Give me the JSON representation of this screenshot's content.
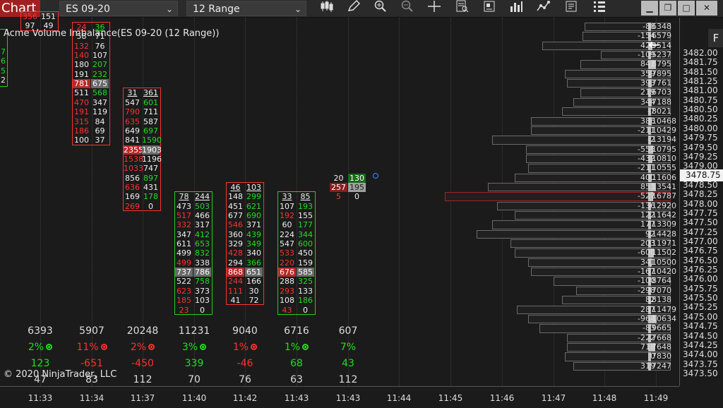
{
  "toolbar": {
    "chart_label": "Chart",
    "instrument": "ES 09-20",
    "interval": "12 Range",
    "icons": [
      "bar-type-icon",
      "draw-pencil-icon",
      "zoom-in-icon",
      "zoom-out-icon",
      "crosshair-icon",
      "data-box-icon",
      "templates-icon",
      "indicators-icon",
      "strategies-icon",
      "properties-icon",
      "more-icon"
    ],
    "window_buttons": [
      "minimize",
      "maximize",
      "close"
    ]
  },
  "chart_title": "Acme Volume Imbalance(ES 09-20 (12 Range))",
  "copyright": "© 2020 NinjaTrader, LLC",
  "price_axis": {
    "labels": [
      "3482.00",
      "3481.75",
      "3481.50",
      "3481.25",
      "3481.00",
      "3480.75",
      "3480.50",
      "3480.25",
      "3480.00",
      "3479.75",
      "3479.50",
      "3479.25",
      "3479.00",
      "3478.75",
      "3478.50",
      "3478.25",
      "3478.00",
      "3477.75",
      "3477.50",
      "3477.25",
      "3477.00",
      "3476.75",
      "3476.50",
      "3476.25",
      "3476.00",
      "3475.75",
      "3475.50",
      "3475.25",
      "3475.00",
      "3474.75",
      "3474.50",
      "3474.25",
      "3474.00",
      "3473.75",
      "3473.50"
    ],
    "current_price": "3478.75",
    "right_button": "F"
  },
  "time_axis": [
    "11:33",
    "11:34",
    "11:37",
    "11:40",
    "11:42",
    "11:43",
    "11:43",
    "11:44",
    "11:45",
    "11:46",
    "11:47",
    "11:48",
    "11:49"
  ],
  "bars": [
    {
      "rows": [
        [
          "356",
          "151"
        ],
        [
          "97",
          "49"
        ]
      ]
    },
    {
      "rows": [
        [
          "24",
          "36"
        ],
        [
          "58",
          "71"
        ],
        [
          "132",
          "76"
        ],
        [
          "140",
          "107"
        ],
        [
          "180",
          "207"
        ],
        [
          "191",
          "232"
        ],
        [
          "781",
          "675"
        ],
        [
          "511",
          "568"
        ],
        [
          "470",
          "347"
        ],
        [
          "191",
          "119"
        ],
        [
          "315",
          "84"
        ],
        [
          "186",
          "69"
        ],
        [
          "100",
          "37"
        ]
      ]
    },
    {
      "rows": [
        [
          "31",
          "361"
        ],
        [
          "547",
          "601"
        ],
        [
          "790",
          "711"
        ],
        [
          "635",
          "587"
        ],
        [
          "649",
          "697"
        ],
        [
          "841",
          "1590"
        ],
        [
          "2355",
          "1903"
        ],
        [
          "1538",
          "1196"
        ],
        [
          "1033",
          "747"
        ],
        [
          "856",
          "897"
        ],
        [
          "636",
          "431"
        ],
        [
          "169",
          "178"
        ],
        [
          "269",
          "0"
        ]
      ]
    },
    {
      "rows": [
        [
          "78",
          "244"
        ],
        [
          "473",
          "503"
        ],
        [
          "517",
          "466"
        ],
        [
          "332",
          "317"
        ],
        [
          "347",
          "412"
        ],
        [
          "611",
          "653"
        ],
        [
          "499",
          "832"
        ],
        [
          "499",
          "338"
        ],
        [
          "737",
          "786"
        ],
        [
          "522",
          "758"
        ],
        [
          "623",
          "373"
        ],
        [
          "185",
          "103"
        ],
        [
          "23",
          "0"
        ]
      ]
    },
    {
      "rows": [
        [
          "46",
          "103"
        ],
        [
          "148",
          "299"
        ],
        [
          "451",
          "621"
        ],
        [
          "677",
          "690"
        ],
        [
          "546",
          "371"
        ],
        [
          "360",
          "439"
        ],
        [
          "329",
          "349"
        ],
        [
          "428",
          "340"
        ],
        [
          "294",
          "366"
        ],
        [
          "868",
          "651"
        ],
        [
          "244",
          "166"
        ],
        [
          "111",
          "30"
        ],
        [
          "41",
          "72"
        ]
      ]
    },
    {
      "rows": [
        [
          "33",
          "85"
        ],
        [
          "107",
          "193"
        ],
        [
          "192",
          "155"
        ],
        [
          "60",
          "177"
        ],
        [
          "224",
          "344"
        ],
        [
          "547",
          "600"
        ],
        [
          "533",
          "450"
        ],
        [
          "220",
          "159"
        ],
        [
          "676",
          "585"
        ],
        [
          "288",
          "325"
        ],
        [
          "293",
          "133"
        ],
        [
          "108",
          "186"
        ],
        [
          "43",
          "0"
        ]
      ]
    },
    {
      "rows": [
        [
          "20",
          "130"
        ],
        [
          "257",
          "195"
        ],
        [
          "5",
          "0"
        ]
      ]
    }
  ],
  "left_edge_digits": [
    "7",
    "6",
    "5",
    "2"
  ],
  "summary": [
    {
      "volume": "6393",
      "pct": "2%",
      "delta": "123",
      "trades": "47"
    },
    {
      "volume": "5907",
      "pct": "11%",
      "delta": "-651",
      "trades": "83"
    },
    {
      "volume": "20248",
      "pct": "2%",
      "delta": "-450",
      "trades": "112"
    },
    {
      "volume": "11231",
      "pct": "3%",
      "delta": "339",
      "trades": "70"
    },
    {
      "volume": "9040",
      "pct": "1%",
      "delta": "-46",
      "trades": "76"
    },
    {
      "volume": "6716",
      "pct": "1%",
      "delta": "68",
      "trades": "63"
    },
    {
      "volume": "607",
      "pct": "7%",
      "delta": "43",
      "trades": "112"
    }
  ],
  "profile": [
    {
      "delta": "-88",
      "vol": "6348",
      "level": 0.38
    },
    {
      "delta": "-154",
      "vol": "6579",
      "level": 0.39
    },
    {
      "delta": "420",
      "vol": "9514",
      "level": 0.57
    },
    {
      "delta": "-109",
      "vol": "5237",
      "level": 0.31
    },
    {
      "delta": "841",
      "vol": "6795",
      "level": 0.4
    },
    {
      "delta": "359",
      "vol": "7895",
      "level": 0.47
    },
    {
      "delta": "393",
      "vol": "7761",
      "level": 0.46
    },
    {
      "delta": "219",
      "vol": "6703",
      "level": 0.4
    },
    {
      "delta": "344",
      "vol": "7188",
      "level": 0.43
    },
    {
      "delta": "-7",
      "vol": "8021",
      "level": 0.48
    },
    {
      "delta": "386",
      "vol": "10468",
      "level": 0.62
    },
    {
      "delta": "-211",
      "vol": "10429",
      "level": 0.62
    },
    {
      "delta": "-2",
      "vol": "13194",
      "level": 0.79
    },
    {
      "delta": "-555",
      "vol": "10795",
      "level": 0.64
    },
    {
      "delta": "-432",
      "vol": "10810",
      "level": 0.64
    },
    {
      "delta": "-211",
      "vol": "10555",
      "level": 0.63
    },
    {
      "delta": "400",
      "vol": "11606",
      "level": 0.69
    },
    {
      "delta": "851",
      "vol": "13541",
      "level": 0.81
    },
    {
      "delta": "-527",
      "vol": "16787",
      "level": 1.0
    },
    {
      "delta": "-136",
      "vol": "12920",
      "level": 0.77
    },
    {
      "delta": "122",
      "vol": "11642",
      "level": 0.69
    },
    {
      "delta": "177",
      "vol": "13309",
      "level": 0.79
    },
    {
      "delta": "92",
      "vol": "14428",
      "level": 0.86
    },
    {
      "delta": "203",
      "vol": "11971",
      "level": 0.71
    },
    {
      "delta": "-600",
      "vol": "11502",
      "level": 0.69
    },
    {
      "delta": "341",
      "vol": "10500",
      "level": 0.63
    },
    {
      "delta": "-167",
      "vol": "10420",
      "level": 0.62
    },
    {
      "delta": "-100",
      "vol": "8764",
      "level": 0.52
    },
    {
      "delta": "-298",
      "vol": "7070",
      "level": 0.42
    },
    {
      "delta": "82",
      "vol": "8138",
      "level": 0.48
    },
    {
      "delta": "287",
      "vol": "11479",
      "level": 0.68
    },
    {
      "delta": "-964",
      "vol": "10634",
      "level": 0.63
    },
    {
      "delta": "-83",
      "vol": "9665",
      "level": 0.58
    },
    {
      "delta": "-222",
      "vol": "7668",
      "level": 0.46
    },
    {
      "delta": "718",
      "vol": "7648",
      "level": 0.46
    },
    {
      "delta": "0",
      "vol": "7830",
      "level": 0.47
    },
    {
      "delta": "319",
      "vol": "7247",
      "level": 0.43
    }
  ],
  "colors": {
    "red": "#ff3030",
    "green": "#22dd22",
    "white": "#f0f0f0",
    "grey": "#cfcfcf",
    "poc": "#a82020"
  }
}
